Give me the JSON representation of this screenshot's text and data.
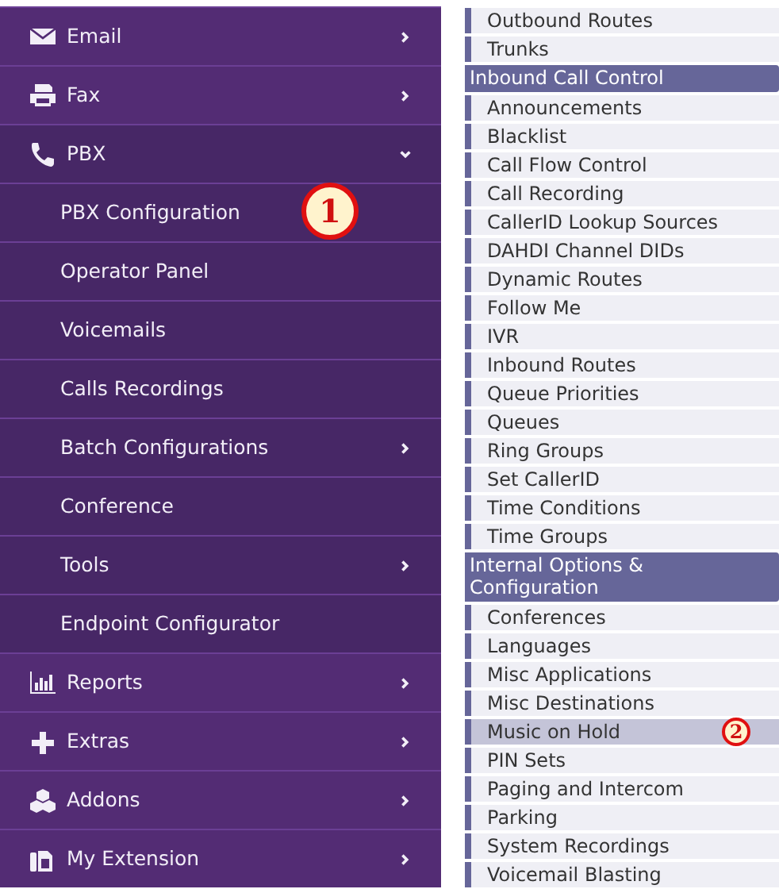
{
  "sidebar": {
    "items": [
      {
        "label": "Email",
        "expanded": false
      },
      {
        "label": "Fax",
        "expanded": false
      },
      {
        "label": "PBX",
        "expanded": true,
        "children": [
          {
            "label": "PBX Configuration",
            "submenu": false,
            "marker": "1"
          },
          {
            "label": "Operator Panel",
            "submenu": false
          },
          {
            "label": "Voicemails",
            "submenu": false
          },
          {
            "label": "Calls Recordings",
            "submenu": false
          },
          {
            "label": "Batch Configurations",
            "submenu": true
          },
          {
            "label": "Conference",
            "submenu": false
          },
          {
            "label": "Tools",
            "submenu": true
          },
          {
            "label": "Endpoint Configurator",
            "submenu": false
          }
        ]
      },
      {
        "label": "Reports",
        "expanded": false
      },
      {
        "label": "Extras",
        "expanded": false
      },
      {
        "label": "Addons",
        "expanded": false
      },
      {
        "label": "My Extension",
        "expanded": false
      }
    ]
  },
  "config_menu": {
    "sections": [
      {
        "items": [
          {
            "label": "Outbound Routes",
            "selected": false
          },
          {
            "label": "Trunks",
            "selected": false
          }
        ]
      },
      {
        "title": "Inbound Call Control",
        "items": [
          {
            "label": "Announcements",
            "selected": false
          },
          {
            "label": "Blacklist",
            "selected": false
          },
          {
            "label": "Call Flow Control",
            "selected": false
          },
          {
            "label": "Call Recording",
            "selected": false
          },
          {
            "label": "CallerID Lookup Sources",
            "selected": false
          },
          {
            "label": "DAHDI Channel DIDs",
            "selected": false
          },
          {
            "label": "Dynamic Routes",
            "selected": false
          },
          {
            "label": "Follow Me",
            "selected": false
          },
          {
            "label": "IVR",
            "selected": false
          },
          {
            "label": "Inbound Routes",
            "selected": false
          },
          {
            "label": "Queue Priorities",
            "selected": false
          },
          {
            "label": "Queues",
            "selected": false
          },
          {
            "label": "Ring Groups",
            "selected": false
          },
          {
            "label": "Set CallerID",
            "selected": false
          },
          {
            "label": "Time Conditions",
            "selected": false
          },
          {
            "label": "Time Groups",
            "selected": false
          }
        ]
      },
      {
        "title": "Internal Options & Configuration",
        "items": [
          {
            "label": "Conferences",
            "selected": false
          },
          {
            "label": "Languages",
            "selected": false
          },
          {
            "label": "Misc Applications",
            "selected": false
          },
          {
            "label": "Misc Destinations",
            "selected": false
          },
          {
            "label": "Music on Hold",
            "selected": true,
            "marker": "2"
          },
          {
            "label": "PIN Sets",
            "selected": false
          },
          {
            "label": "Paging and Intercom",
            "selected": false
          },
          {
            "label": "Parking",
            "selected": false
          },
          {
            "label": "System Recordings",
            "selected": false
          },
          {
            "label": "Voicemail Blasting",
            "selected": false
          }
        ]
      }
    ]
  }
}
